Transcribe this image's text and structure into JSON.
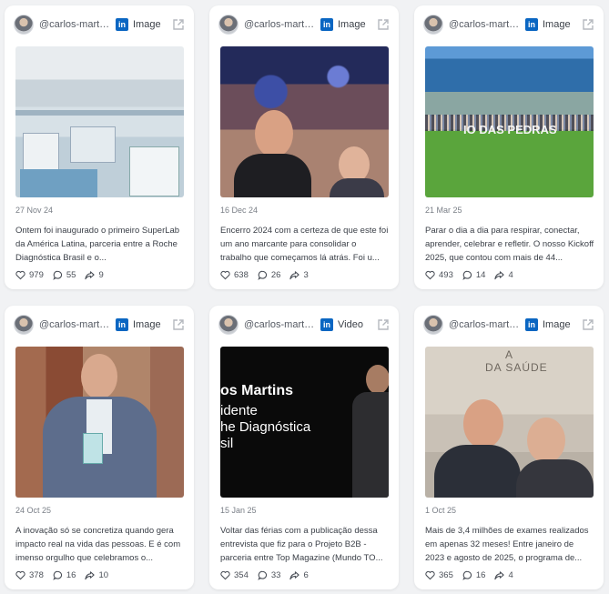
{
  "cards": [
    {
      "handle": "@carlos-martins",
      "network": "in",
      "media_type": "Image",
      "date": "27 Nov 24",
      "text": "Ontem foi inaugurado o primeiro SuperLab da América Latina, parceria entre a Roche Diagnóstica Brasil e o...",
      "likes": "979",
      "comments": "55",
      "shares": "9",
      "image": "office-lab"
    },
    {
      "handle": "@carlos-martins",
      "network": "in",
      "media_type": "Image",
      "date": "16 Dec 24",
      "text": "Encerro 2024 com a certeza de que este foi um ano marcante para consolidar o trabalho que começamos lá atrás. Foi u...",
      "likes": "638",
      "comments": "26",
      "shares": "3",
      "image": "concert-selfie"
    },
    {
      "handle": "@carlos-martins",
      "network": "in",
      "media_type": "Image",
      "date": "21 Mar 25",
      "text": "Parar o dia a dia para respirar, conectar, aprender, celebrar e refletir. O nosso Kickoff 2025, que contou com mais de 44...",
      "likes": "493",
      "comments": "14",
      "shares": "4",
      "image": "beach-group",
      "image_caption": "IO DAS PEDRAS"
    },
    {
      "handle": "@carlos-martins",
      "network": "in",
      "media_type": "Image",
      "date": "24 Oct 25",
      "text": "A inovação só se concretiza quando gera impacto real na vida das pessoas. E é com imenso orgulho que celebramos o...",
      "likes": "378",
      "comments": "16",
      "shares": "10",
      "image": "award-portrait"
    },
    {
      "handle": "@carlos-martins",
      "network": "in",
      "media_type": "Video",
      "date": "15 Jan 25",
      "text": "Voltar das férias com a publicação dessa entrevista que fiz para o Projeto B2B - parceria entre Top Magazine (Mundo TO...",
      "likes": "354",
      "comments": "33",
      "shares": "6",
      "image": "interview-video",
      "video_lines": [
        "os Martins",
        "idente",
        "he Diagnóstica",
        "sil"
      ]
    },
    {
      "handle": "@carlos-martins",
      "network": "in",
      "media_type": "Image",
      "date": "1 Oct 25",
      "text": "Mais de 3,4 milhões de exames realizados em apenas 32 meses! Entre janeiro de 2023 e agosto de 2025, o programa de...",
      "likes": "365",
      "comments": "16",
      "shares": "4",
      "image": "selfie-building",
      "image_caption": "DA SAÚDE",
      "image_caption_top": "A"
    }
  ],
  "colors": {
    "linkedin": "#0a66c2",
    "card_bg": "#ffffff",
    "page_bg": "#f1f2f4",
    "muted": "#7a7f87"
  },
  "icons": {
    "likes": "heart-icon",
    "comments": "comment-icon",
    "shares": "share-icon",
    "open": "external-link-icon"
  }
}
